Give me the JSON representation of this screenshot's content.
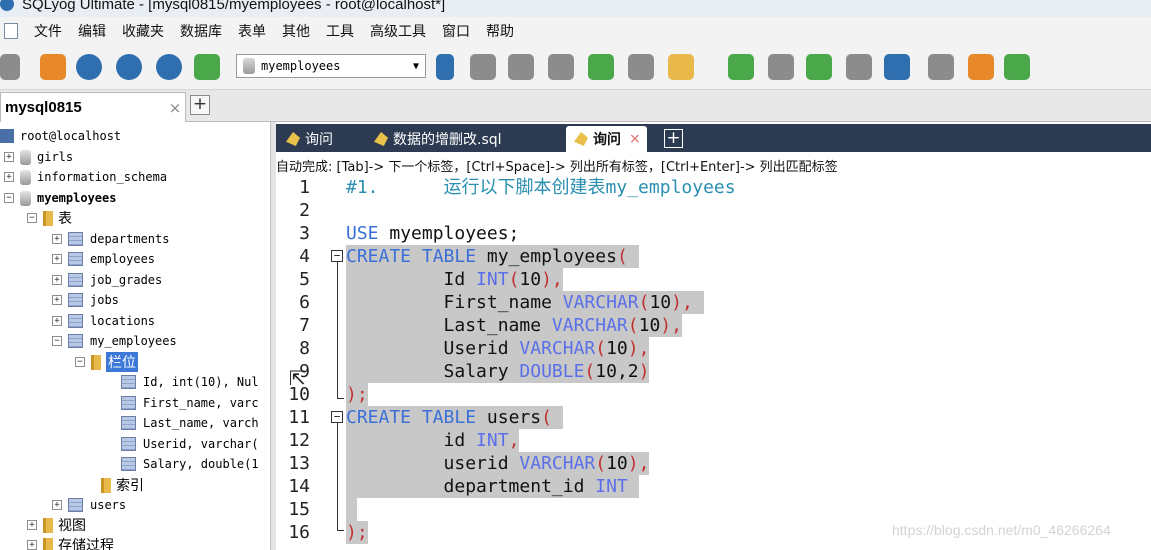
{
  "window": {
    "title": "SQLyog Ultimate - [mysql0815/myemployees - root@localhost*]"
  },
  "menu": [
    "文件",
    "编辑",
    "收藏夹",
    "数据库",
    "表单",
    "其他",
    "工具",
    "高级工具",
    "窗口",
    "帮助"
  ],
  "toolbar": {
    "icons": [
      "connect-icon",
      "new-query-icon",
      "execute-icon",
      "execute-all-icon",
      "refresh-icon",
      "stop-icon",
      "backup-icon",
      "restore-icon",
      "import-icon",
      "export-icon",
      "table-icon",
      "schema-icon",
      "sync-icon",
      "compare-icon",
      "join-icon",
      "query-builder-icon",
      "schema-designer-icon",
      "data-search-icon",
      "report-icon"
    ],
    "database_select": {
      "value": "myemployees"
    },
    "colors": {
      "blue": "#2f6fb0",
      "green": "#4aa84a",
      "orange": "#e8882b",
      "gray": "#8c8c8c"
    }
  },
  "connection_tab": {
    "label": "mysql0815",
    "close": "×",
    "add": "+"
  },
  "tree": {
    "host": "root@localhost",
    "databases": [
      {
        "name": "girls",
        "state": "+"
      },
      {
        "name": "information_schema",
        "state": "+"
      },
      {
        "name": "myemployees",
        "state": "−",
        "bold": true
      }
    ],
    "tables_folder": "表",
    "tables": [
      {
        "name": "departments",
        "state": "+"
      },
      {
        "name": "employees",
        "state": "+"
      },
      {
        "name": "job_grades",
        "state": "+"
      },
      {
        "name": "jobs",
        "state": "+"
      },
      {
        "name": "locations",
        "state": "+"
      },
      {
        "name": "my_employees",
        "state": "−"
      }
    ],
    "columns_folder": "栏位",
    "columns": [
      "Id, int(10), Nul",
      "First_name, varc",
      "Last_name, varch",
      "Userid, varchar(",
      "Salary, double(1"
    ],
    "index_folder": "索引",
    "users_table": "users",
    "views_folder": "视图",
    "procs_folder": "存储过程"
  },
  "query_tabs": {
    "tabs": [
      {
        "label": "询问"
      },
      {
        "label": "数据的增删改.sql"
      },
      {
        "label": "询问",
        "active": true,
        "close": "×"
      }
    ],
    "add": "+"
  },
  "hint": "自动完成: [Tab]-> 下一个标签，[Ctrl+Space]-> 列出所有标签，[Ctrl+Enter]-> 列出匹配标签",
  "editor": {
    "line_numbers": [
      "1",
      "2",
      "3",
      "4",
      "5",
      "6",
      "7",
      "8",
      "9",
      "10",
      "11",
      "12",
      "13",
      "14",
      "15",
      "16"
    ],
    "lines": [
      {
        "parts": [
          [
            "c-comment",
            "#1.      "
          ],
          [
            "c-cjk",
            "运行以下脚本创建表"
          ],
          [
            "c-comment",
            "my_employees"
          ]
        ]
      },
      {
        "parts": []
      },
      {
        "parts": [
          [
            "c-kw",
            "USE"
          ],
          [
            "c-id",
            " myemployees;"
          ]
        ]
      },
      {
        "hl": true,
        "parts": [
          [
            "c-kw",
            "CREATE"
          ],
          [
            "c-id",
            " "
          ],
          [
            "c-kw",
            "TABLE"
          ],
          [
            "c-id",
            " my_employees"
          ],
          [
            "c-op",
            "("
          ],
          [
            "c-id",
            " "
          ]
        ]
      },
      {
        "hl": true,
        "parts": [
          [
            "c-id",
            "         Id "
          ],
          [
            "c-type",
            "INT"
          ],
          [
            "c-op",
            "("
          ],
          [
            "c-num",
            "10"
          ],
          [
            "c-op",
            "),"
          ]
        ]
      },
      {
        "hl": true,
        "parts": [
          [
            "c-id",
            "         First_name "
          ],
          [
            "c-type",
            "VARCHAR"
          ],
          [
            "c-op",
            "("
          ],
          [
            "c-num",
            "10"
          ],
          [
            "c-op",
            "),"
          ],
          [
            "c-id",
            " "
          ]
        ]
      },
      {
        "hl": true,
        "parts": [
          [
            "c-id",
            "         Last_name "
          ],
          [
            "c-type",
            "VARCHAR"
          ],
          [
            "c-op",
            "("
          ],
          [
            "c-num",
            "10"
          ],
          [
            "c-op",
            "),"
          ]
        ]
      },
      {
        "hl": true,
        "parts": [
          [
            "c-id",
            "         Userid "
          ],
          [
            "c-type",
            "VARCHAR"
          ],
          [
            "c-op",
            "("
          ],
          [
            "c-num",
            "10"
          ],
          [
            "c-op",
            "),"
          ]
        ]
      },
      {
        "hl": true,
        "parts": [
          [
            "c-id",
            "         Salary "
          ],
          [
            "c-type",
            "DOUBLE"
          ],
          [
            "c-op",
            "("
          ],
          [
            "c-num",
            "10,2"
          ],
          [
            "c-op",
            ")"
          ]
        ]
      },
      {
        "hl": true,
        "parts": [
          [
            "c-op",
            ");"
          ]
        ]
      },
      {
        "hl": true,
        "parts": [
          [
            "c-kw",
            "CREATE"
          ],
          [
            "c-id",
            " "
          ],
          [
            "c-kw",
            "TABLE"
          ],
          [
            "c-id",
            " users"
          ],
          [
            "c-op",
            "("
          ],
          [
            "c-id",
            " "
          ]
        ]
      },
      {
        "hl": true,
        "parts": [
          [
            "c-id",
            "         id "
          ],
          [
            "c-type",
            "INT"
          ],
          [
            "c-op",
            ","
          ]
        ]
      },
      {
        "hl": true,
        "parts": [
          [
            "c-id",
            "         userid "
          ],
          [
            "c-type",
            "VARCHAR"
          ],
          [
            "c-op",
            "("
          ],
          [
            "c-num",
            "10"
          ],
          [
            "c-op",
            "),"
          ]
        ]
      },
      {
        "hl": true,
        "parts": [
          [
            "c-id",
            "         department_id "
          ],
          [
            "c-type",
            "INT"
          ],
          [
            "c-id",
            " "
          ]
        ]
      },
      {
        "hl": true,
        "parts": [
          [
            "c-id",
            " "
          ]
        ]
      },
      {
        "hl": true,
        "parts": [
          [
            "c-op",
            ");"
          ]
        ]
      }
    ]
  },
  "watermark": "https://blog.csdn.net/m0_46266264"
}
